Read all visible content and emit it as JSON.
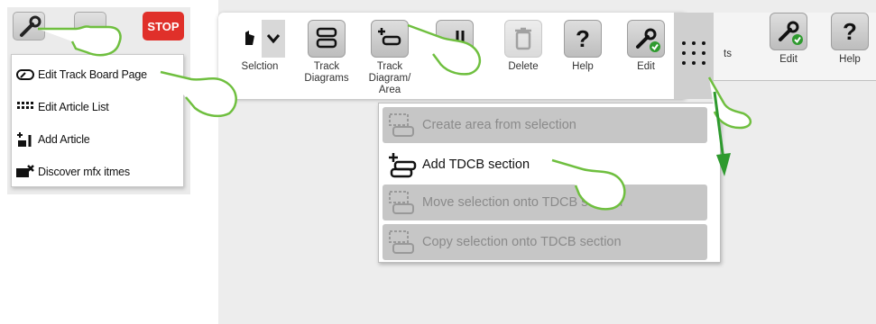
{
  "left_panel": {
    "stop_label": "STOP",
    "dropdown_items": [
      {
        "label": "Edit Track Board Page",
        "icon": "track-board-icon"
      },
      {
        "label": "Edit Article List",
        "icon": "grid-list-icon"
      },
      {
        "label": "Add Article",
        "icon": "add-article-icon"
      },
      {
        "label": "Discover mfx itmes",
        "icon": "discover-icon"
      }
    ]
  },
  "menu_bar": {
    "items": [
      {
        "label": "Selction",
        "icon": "hand-pointer-icon"
      },
      {
        "label": "Track\nDiagrams",
        "icon": "track-diagram-icon"
      },
      {
        "label": "Track\nDiagram/\nArea",
        "icon": "add-area-icon"
      },
      {
        "label": "Delete",
        "icon": "trash-icon"
      },
      {
        "label": "Help",
        "icon": "help-icon"
      },
      {
        "label": "Edit",
        "icon": "wrench-check-icon"
      }
    ],
    "right_items": [
      {
        "label": "ts"
      },
      {
        "label": "Edit",
        "icon": "wrench-check-icon"
      },
      {
        "label": "Help",
        "icon": "help-icon"
      }
    ]
  },
  "submenu": {
    "items": [
      {
        "label": "Create area from selection",
        "enabled": false
      },
      {
        "label": "Add TDCB section",
        "enabled": true
      },
      {
        "label": "Move selection onto TDCB section",
        "enabled": false
      },
      {
        "label": "Copy selection onto TDCB section",
        "enabled": false
      }
    ]
  },
  "colors": {
    "stop": "#e0302a",
    "accent_green": "#2e9a2e",
    "hand_stroke": "#6fbf3f"
  }
}
